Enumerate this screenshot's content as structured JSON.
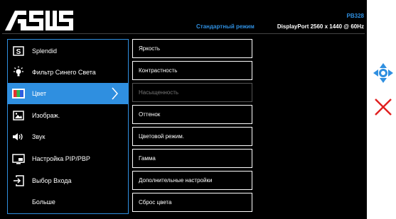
{
  "header": {
    "brand": "ASUS",
    "model": "PB328",
    "mode": "Стандартный режим",
    "input_info": "DisplayPort 2560 x 1440 @ 60Hz"
  },
  "main_menu": [
    {
      "label": "Splendid",
      "icon": "splendid-icon"
    },
    {
      "label": "Фильтр Синего Света",
      "icon": "bluelight-icon"
    },
    {
      "label": "Цвет",
      "icon": "color-icon",
      "selected": true
    },
    {
      "label": "Изображ.",
      "icon": "image-icon"
    },
    {
      "label": "Звук",
      "icon": "speaker-icon"
    },
    {
      "label": "Настройка PIP/PBP",
      "icon": "pip-icon"
    },
    {
      "label": "Выбор Входа",
      "icon": "input-select-icon"
    },
    {
      "label": "Больше",
      "icon": ""
    }
  ],
  "sub_menu": [
    {
      "label": "Яркость"
    },
    {
      "label": "Контрастность"
    },
    {
      "label": "Насыщенность",
      "disabled": true
    },
    {
      "label": "Оттенок"
    },
    {
      "label": "Цветовой режим."
    },
    {
      "label": "Гамма"
    },
    {
      "label": "Дополнительные настройки"
    },
    {
      "label": "Сброс цвета"
    }
  ],
  "side_controls": {
    "navigate_icon": "five-way-nav-icon",
    "close_icon": "close-icon"
  },
  "colors": {
    "accent": "#2f8fe0",
    "background": "#000000",
    "close": "#e02020"
  }
}
